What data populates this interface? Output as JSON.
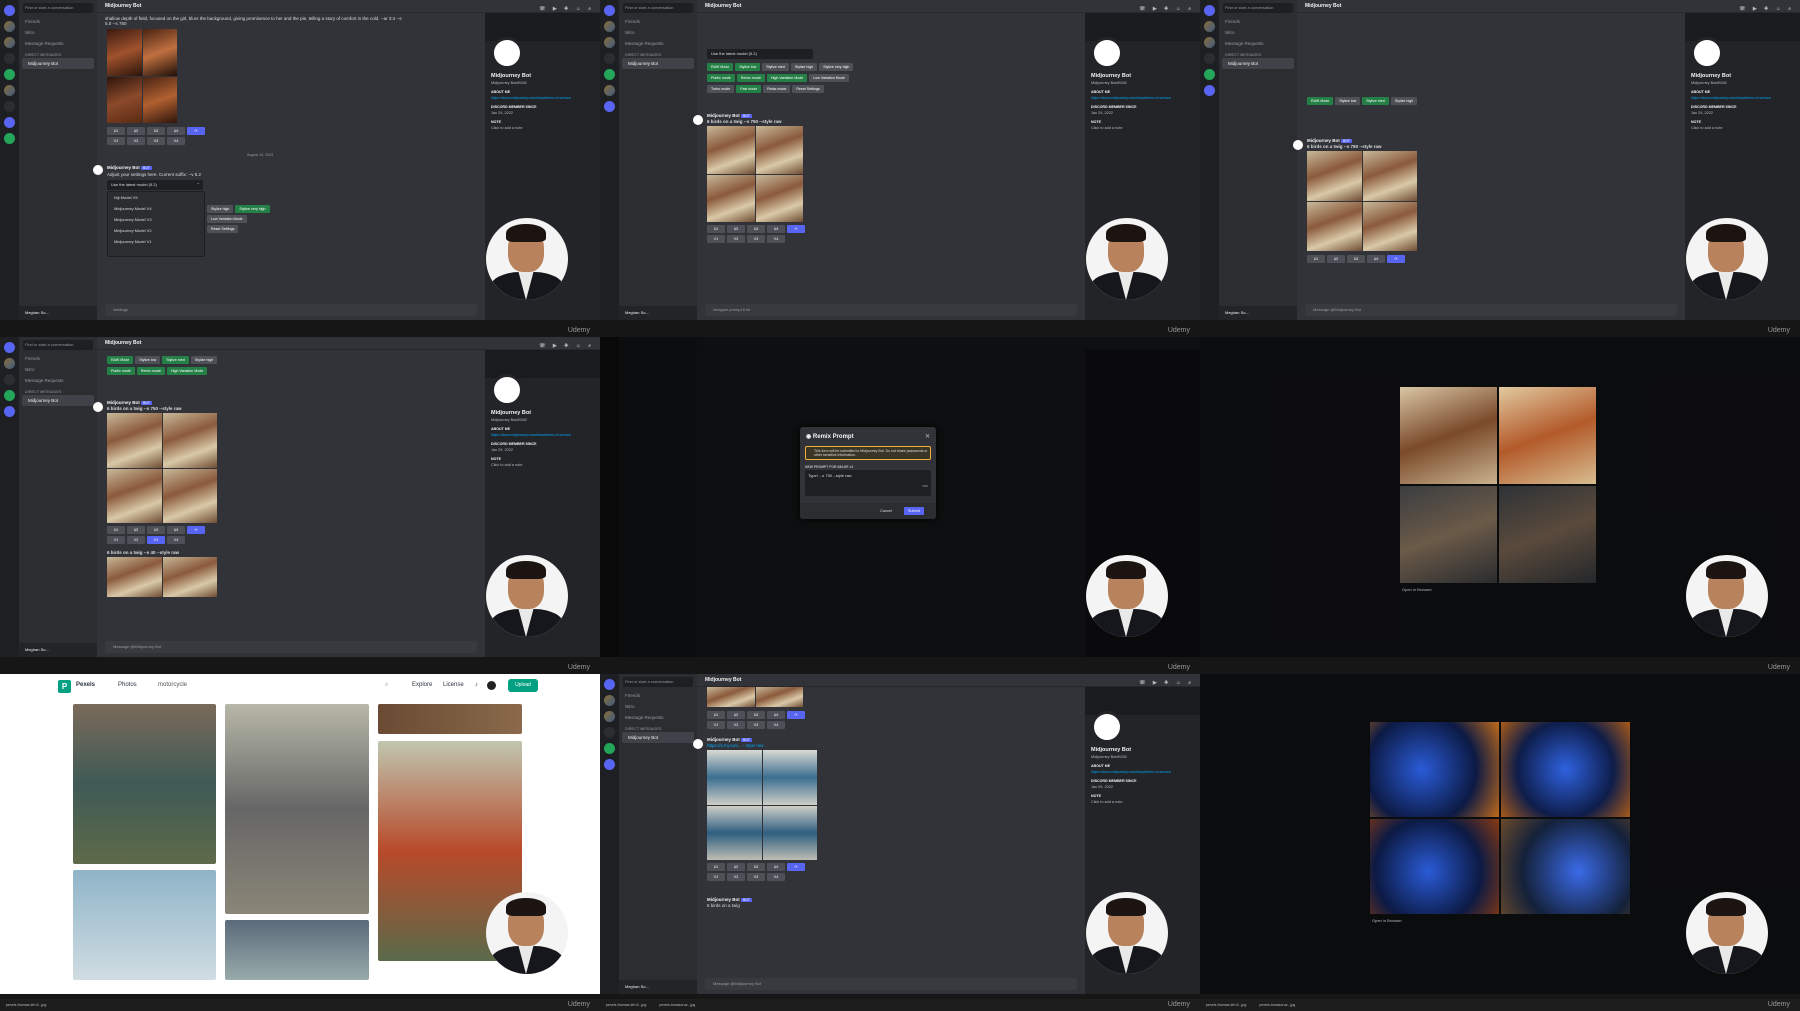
{
  "caption": "Udemy",
  "discord": {
    "search_placeholder": "Find or start a conversation",
    "friends": "Friends",
    "nitro": "Nitro",
    "message_requests": "Message Requests",
    "direct_messages": "DIRECT MESSAGES",
    "dm_name": "Midjourney Bot",
    "channel_title": "Midjourney Bot",
    "user_name": "Meghan So..."
  },
  "profile": {
    "name": "Midjourney Bot",
    "tag": "Midjourney Bot#9282",
    "about_heading": "ABOUT ME",
    "member_since_heading": "DISCORD MEMBER SINCE",
    "member_since": "Jan 29, 2022",
    "note_heading": "NOTE",
    "note_placeholder": "Click to add a note",
    "link": "https://docs.midjourney.com/docs/terms-of-service"
  },
  "cell1": {
    "top_text": "shallow depth of field, focused on the girl, blurs the background, giving prominence to her and the pie, telling a story of comfort in the cold. --ar 3:4 --s 5.0 --s 750",
    "date_divider": "August 19, 2023",
    "settings_text": "Adjust your settings here. Current suffix: --v 5.2",
    "select_value": "Use the latest model (5.2)",
    "options": [
      "Niji Model V5",
      "Midjourney Model V4",
      "Midjourney Model V3",
      "Midjourney Model V2",
      "Midjourney Model V1"
    ],
    "style_high": "Stylize high",
    "style_very_high": "Stylize very high",
    "low_variation": "Low Variation Mode",
    "reset": "Reset Settings",
    "composer": "/settings"
  },
  "cell2": {
    "select_value": "Use the latest model (5.2)",
    "buttons": [
      "RAW Mode",
      "Stylize low",
      "Stylize med",
      "Stylize high",
      "Stylize very high",
      "Public mode",
      "Remix mode",
      "High Variation Mode",
      "Low Variation Mode",
      "Turbo mode",
      "Fast mode",
      "Relax mode",
      "Reset Settings"
    ],
    "prompt": "6 birds on a twig --s 750 --style raw",
    "composer": "/imagine prompt 6 bir"
  },
  "cell3": {
    "prompt": "6 birds on a twig --s 750 --style raw",
    "composer": "Message @Midjourney Bot"
  },
  "cell4": {
    "prompt1": "6 birds on a twig --s 750 --style raw",
    "prompt2": "6 birds on a twig --s 40 --style raw"
  },
  "cell5": {
    "modal_title": "Remix Prompt",
    "warning": "This form will be submitted to Midjourney Bot. Do not share passwords or other sensitive information.",
    "label": "NEW PROMPT FOR IMAGE #4",
    "input_value": "Type! ...s 750 --style raw",
    "counter": "38/6",
    "cancel": "Cancel",
    "submit": "Submit"
  },
  "cell6": {
    "open_original": "Open in Browser"
  },
  "cell7": {
    "brand": "Pexels",
    "photos": "Photos",
    "search": "motorcycle",
    "explore": "Explore",
    "license": "License",
    "upload": "Upload"
  },
  "cell8": {
    "prompt": "https://s.mj.run/... --style raw",
    "footer_text": "6 birds on a twig"
  },
  "cell9": {
    "open_original": "Open in Browser"
  },
  "taskbar": [
    "pexels-thomas-leh-5...jpg",
    "pexels-tomascruz...jpg"
  ],
  "upscale_labels": [
    "U1",
    "U2",
    "U3",
    "U4"
  ],
  "variation_labels": [
    "V1",
    "V2",
    "V3",
    "V4"
  ]
}
